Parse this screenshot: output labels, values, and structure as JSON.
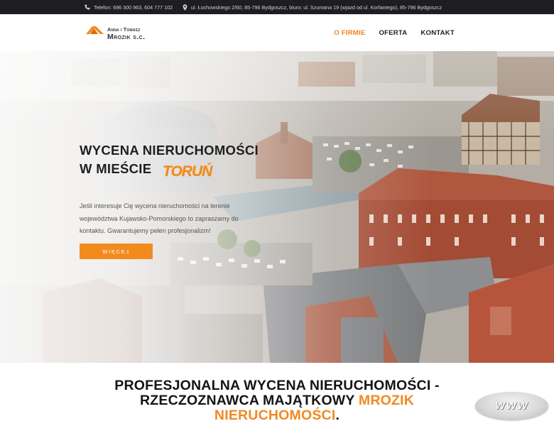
{
  "topbar": {
    "phone": "Telefon: 696 300 963, 604 777 102",
    "address": "ul. Łochowskiego 2/60, 85-796 Bydgoszcz, biuro: ul. Szumana 19 (wjazd od ul. Korfantego), 85-796 Bydgoszcz"
  },
  "logo": {
    "line1": "Anna i Tomasz",
    "line2": "Mrozik s.c."
  },
  "nav": {
    "items": [
      "O FIRMIE",
      "OFERTA",
      "KONTAKT"
    ],
    "active": "O FIRMIE"
  },
  "hero": {
    "title_line1": "WYCENA NIERUCHOMOŚCI",
    "title_line2": "W MIEŚCIE",
    "city": "TORUŃ",
    "text": "Jeśli interesuje Cię wycena nieruchomości na terenie województwa Kujawsko-Pomorskiego to zapraszamy do kontaktu. Gwarantujemy pełen profesjonalizm!",
    "button": "WIĘCEJ"
  },
  "section": {
    "heading_line1": "PROFESJONALNA WYCENA NIERUCHOMOŚCI -",
    "heading_line2": "RZECZOZNAWCA MAJĄTKOWY",
    "heading_accent1": "MROZIK",
    "heading_accent2": "NIERUCHOMOŚCI",
    "heading_end": "."
  },
  "badge": {
    "label": "WWW"
  },
  "colors": {
    "accent": "#f28b1d",
    "topbar": "#1e1d22",
    "text": "#1f1f1f"
  },
  "icons": [
    "phone-icon",
    "location-pin-icon"
  ]
}
